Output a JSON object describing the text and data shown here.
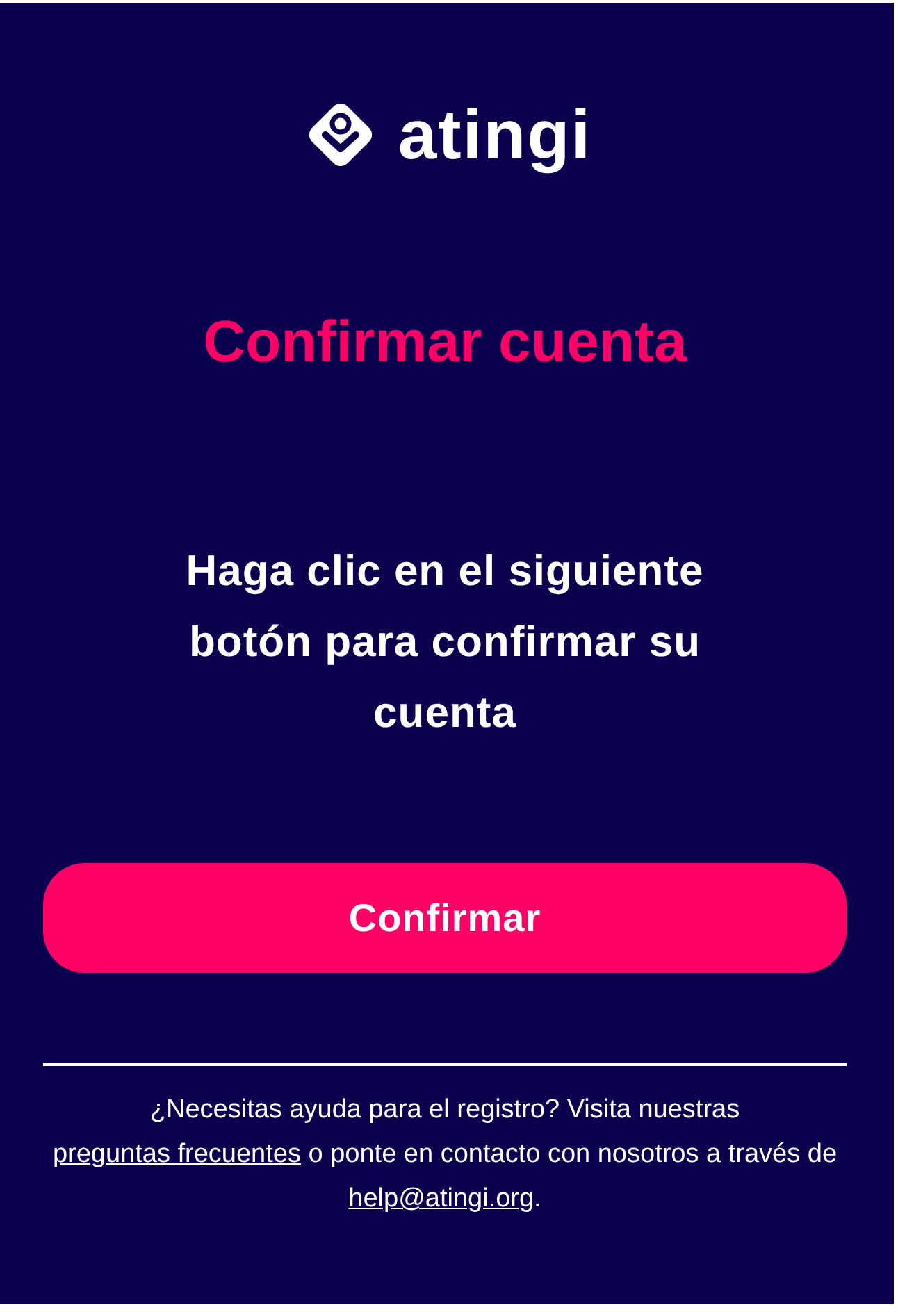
{
  "logo": {
    "wordmark": "atingi"
  },
  "title": "Confirmar cuenta",
  "message": "Haga clic en el siguiente botón para confirmar su cuenta",
  "button": {
    "label": "Confirmar"
  },
  "footer": {
    "before": "¿Necesitas ayuda para el registro? Visita nuestras",
    "faq_link": "preguntas frecuentes",
    "middle": "o ponte en contacto con nosotros a través de",
    "email_link": "help@atingi.org",
    "after": "."
  }
}
